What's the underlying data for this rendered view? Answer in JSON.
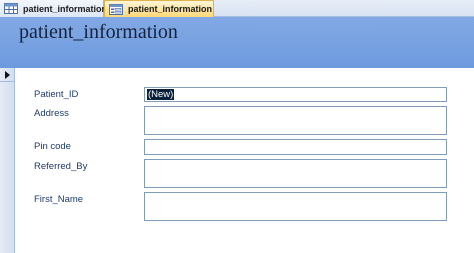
{
  "tabs": [
    {
      "label": "patient_information",
      "icon": "table-icon"
    },
    {
      "label": "patient_information",
      "icon": "form-icon"
    }
  ],
  "form": {
    "title": "patient_information",
    "fields": {
      "patient_id": {
        "label": "Patient_ID",
        "value": "(New)"
      },
      "address": {
        "label": "Address",
        "value": ""
      },
      "pin_code": {
        "label": "Pin code",
        "value": ""
      },
      "referred_by": {
        "label": "Referred_By",
        "value": ""
      },
      "first_name": {
        "label": "First_Name",
        "value": ""
      }
    }
  },
  "colors": {
    "header": "#7aa3e2",
    "active_tab": "#ffd776",
    "label_text": "#1e3b6b"
  }
}
